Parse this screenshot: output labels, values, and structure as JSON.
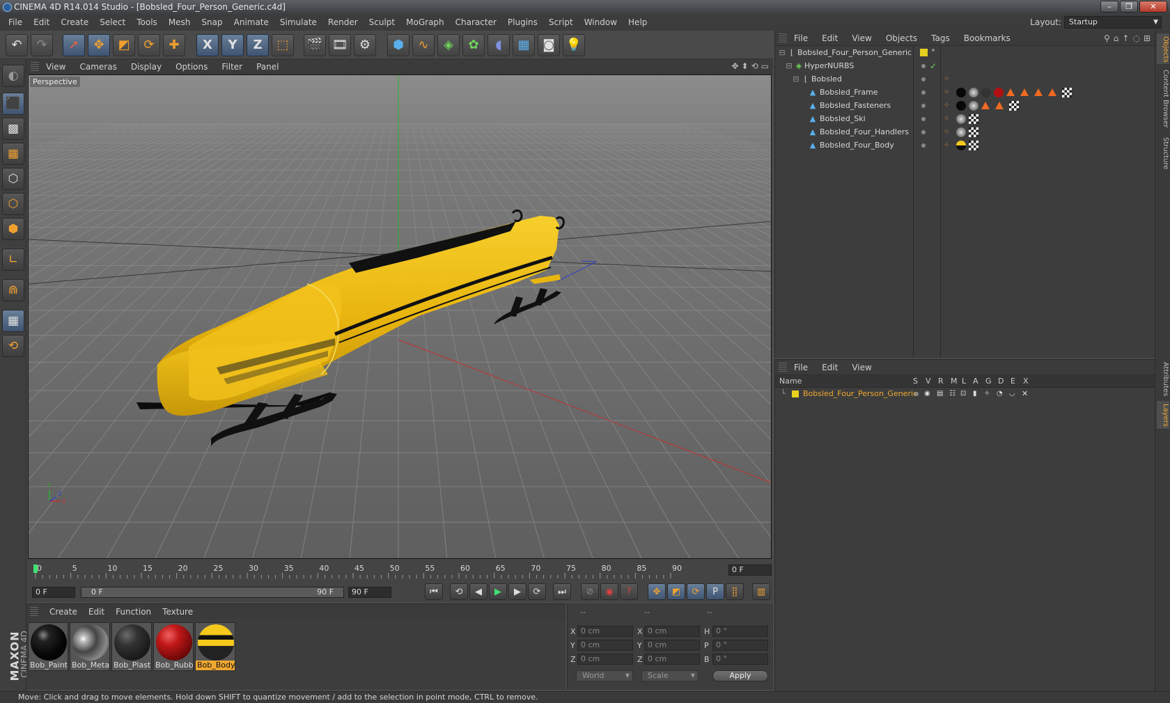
{
  "window": {
    "title": "CINEMA 4D R14.014 Studio - [Bobsled_Four_Person_Generic.c4d]"
  },
  "menu": [
    "File",
    "Edit",
    "Create",
    "Select",
    "Tools",
    "Mesh",
    "Snap",
    "Animate",
    "Simulate",
    "Render",
    "Sculpt",
    "MoGraph",
    "Character",
    "Plugins",
    "Script",
    "Window",
    "Help"
  ],
  "layout": {
    "label": "Layout:",
    "value": "Startup"
  },
  "toolbar": {
    "x_label": "X",
    "y_label": "Y",
    "z_label": "Z"
  },
  "viewport": {
    "menu": [
      "View",
      "Cameras",
      "Display",
      "Options",
      "Filter",
      "Panel"
    ],
    "label": "Perspective",
    "axis": {
      "x": "X",
      "y": "Y",
      "z": "Z"
    }
  },
  "timeline": {
    "ticks": [
      "0",
      "5",
      "10",
      "15",
      "20",
      "25",
      "30",
      "35",
      "40",
      "45",
      "50",
      "55",
      "60",
      "65",
      "70",
      "75",
      "80",
      "85",
      "90"
    ],
    "current_frame": "0 F"
  },
  "transport": {
    "start_frame": "0 F",
    "range_start": "0 F",
    "range_end": "90 F",
    "end_frame": "90 F",
    "p_label": "P"
  },
  "materials": {
    "menu": [
      "Create",
      "Edit",
      "Function",
      "Texture"
    ],
    "items": [
      {
        "name": "Bob_Paint",
        "color": "#0a0a0a"
      },
      {
        "name": "Bob_Metal",
        "color": "#7a7a7a"
      },
      {
        "name": "Bob_Plastic",
        "color": "#2a2a2a"
      },
      {
        "name": "Bob_Rubber",
        "color": "#b01010"
      },
      {
        "name": "Bob_Body",
        "color": "#e8b018"
      }
    ],
    "selected": "Bob_Body"
  },
  "coordinates": {
    "headers": [
      "--",
      "--",
      "--"
    ],
    "rows": [
      {
        "l1": "X",
        "v1": "0 cm",
        "l2": "X",
        "v2": "0 cm",
        "l3": "H",
        "v3": "0 °"
      },
      {
        "l1": "Y",
        "v1": "0 cm",
        "l2": "Y",
        "v2": "0 cm",
        "l3": "P",
        "v3": "0 °"
      },
      {
        "l1": "Z",
        "v1": "0 cm",
        "l2": "Z",
        "v2": "0 cm",
        "l3": "B",
        "v3": "0 °"
      }
    ],
    "space": "World",
    "mode": "Scale",
    "apply": "Apply"
  },
  "objects": {
    "menu": [
      "File",
      "Edit",
      "View",
      "Objects",
      "Tags",
      "Bookmarks"
    ],
    "rows": [
      {
        "name": "Bobsled_Four_Person_Generic"
      },
      {
        "name": "HyperNURBS"
      },
      {
        "name": "Bobsled"
      },
      {
        "name": "Bobsled_Frame"
      },
      {
        "name": "Bobsled_Fasteners"
      },
      {
        "name": "Bobsled_Ski"
      },
      {
        "name": "Bobsled_Four_Handlers"
      },
      {
        "name": "Bobsled_Four_Body"
      }
    ]
  },
  "layers": {
    "menu": [
      "File",
      "Edit",
      "View"
    ],
    "columns": [
      "Name",
      "S",
      "V",
      "R",
      "M",
      "L",
      "A",
      "G",
      "D",
      "E",
      "X"
    ],
    "rows": [
      {
        "name": "Bobsled_Four_Person_Generic",
        "color": "#e8d020"
      }
    ]
  },
  "side_tabs": [
    "Objects",
    "Content Browser",
    "Structure",
    "Attributes",
    "Layers"
  ],
  "status": "Move: Click and drag to move elements. Hold down SHIFT to quantize movement / add to the selection in point mode, CTRL to remove.",
  "branding": {
    "maxon": "MAXON",
    "product": "CINEMA 4D"
  },
  "colors": {
    "accent": "#f0a830",
    "layer_row_text": "#f0a830",
    "body_yellow": "#f2be12"
  }
}
